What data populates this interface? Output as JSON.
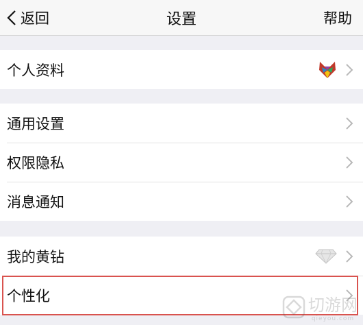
{
  "navbar": {
    "back_label": "返回",
    "title": "设置",
    "help_label": "帮助"
  },
  "groups": [
    {
      "items": [
        {
          "label": "个人资料",
          "icon": "fox-avatar-icon"
        }
      ]
    },
    {
      "items": [
        {
          "label": "通用设置"
        },
        {
          "label": "权限隐私"
        },
        {
          "label": "消息通知"
        }
      ]
    },
    {
      "items": [
        {
          "label": "我的黄钻",
          "icon": "diamond-icon"
        },
        {
          "label": "个性化"
        }
      ]
    }
  ],
  "watermark": {
    "text": "切游网",
    "subtext": "qieyou.com"
  },
  "colors": {
    "highlight_border": "#d9534f",
    "background": "#efeff4"
  }
}
